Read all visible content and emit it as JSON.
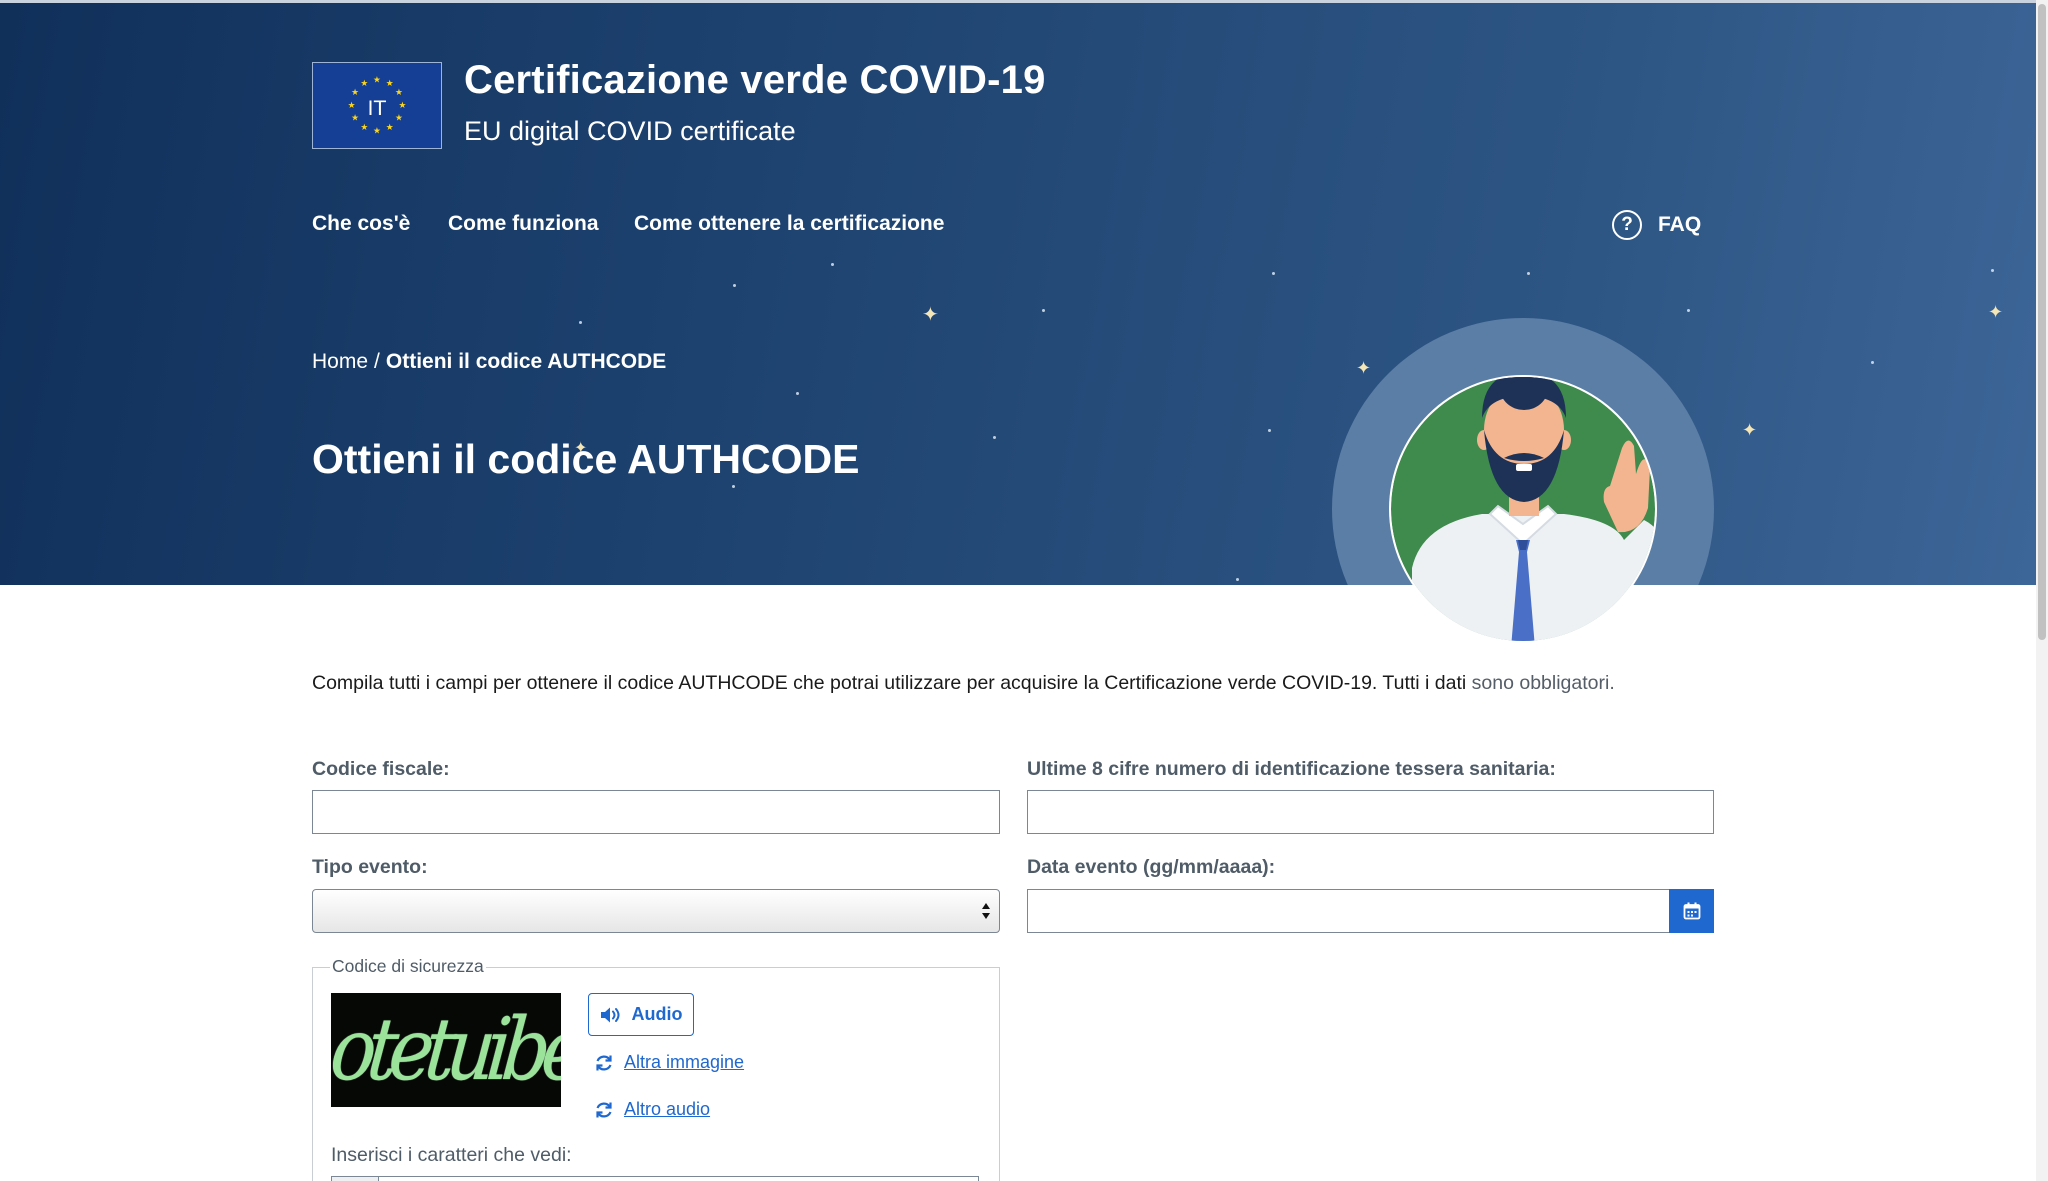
{
  "header": {
    "flag_code": "IT",
    "title": "Certificazione verde COVID-19",
    "subtitle": "EU digital COVID certificate"
  },
  "nav": {
    "items": [
      {
        "label": "Che cos'è"
      },
      {
        "label": "Come funziona"
      },
      {
        "label": "Come ottenere la certificazione"
      }
    ],
    "faq_label": "FAQ"
  },
  "breadcrumb": {
    "home": "Home",
    "separator": "/",
    "current": "Ottieni il codice AUTHCODE"
  },
  "page_title": "Ottieni il codice AUTHCODE",
  "intro": {
    "text": "Compila tutti i campi per ottenere il codice AUTHCODE che potrai utilizzare per acquisire la Certificazione verde COVID-19. Tutti i dati ",
    "required_note": "sono obbligatori."
  },
  "form": {
    "codice_fiscale": {
      "label": "Codice fiscale:",
      "value": ""
    },
    "tessera": {
      "label": "Ultime 8 cifre numero di identificazione tessera sanitaria:",
      "value": ""
    },
    "tipo_evento": {
      "label": "Tipo evento:",
      "selected": ""
    },
    "data_evento": {
      "label": "Data evento (gg/mm/aaaa):",
      "value": ""
    }
  },
  "captcha": {
    "legend": "Codice di sicurezza",
    "image_text": "otetuibe",
    "audio_label": "Audio",
    "altra_immagine": "Altra immagine",
    "altro_audio": "Altro audio",
    "input_label": "Inserisci i caratteri che vedi:"
  },
  "colors": {
    "hero_dark": "#10305a",
    "hero_light": "#3d6698",
    "accent_blue": "#1f68cf",
    "label_gray": "#4f5c68",
    "illustration_green": "#3f8a4d"
  },
  "icons": [
    "eu-flag-icon",
    "help-circle-icon",
    "calendar-icon",
    "speaker-icon",
    "refresh-icon",
    "select-arrows-icon"
  ]
}
